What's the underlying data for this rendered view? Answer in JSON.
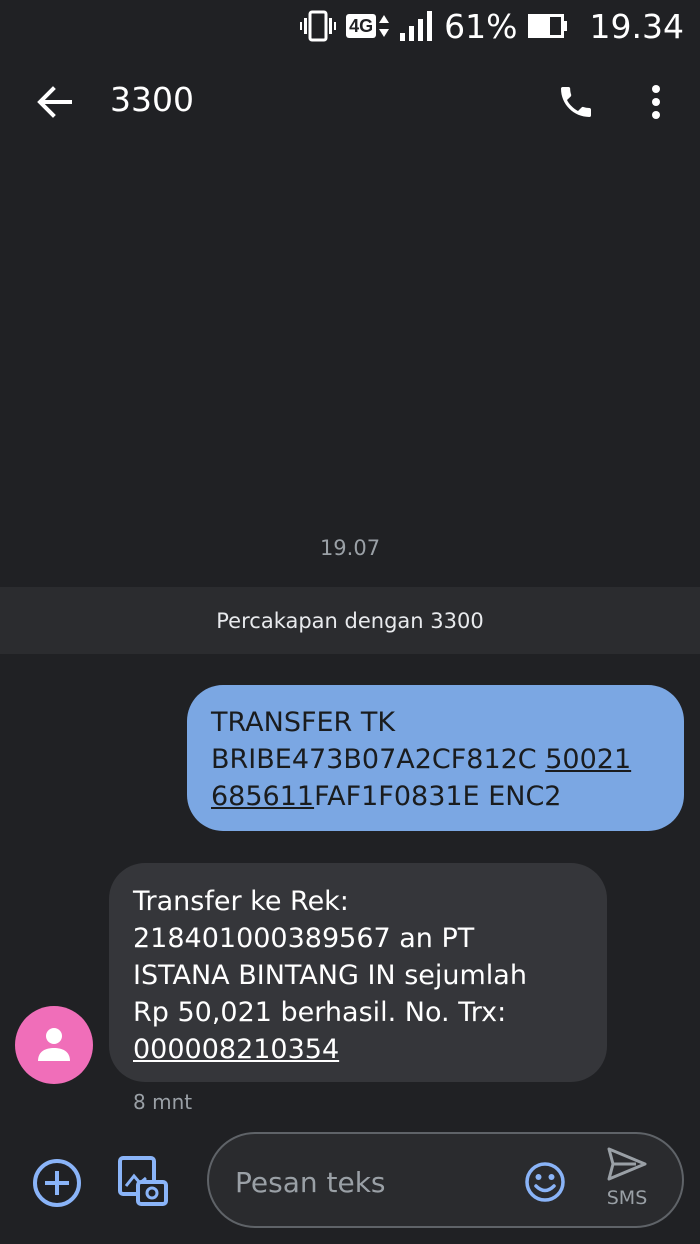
{
  "status_bar": {
    "network": "4G",
    "battery": "61%",
    "time": "19.34"
  },
  "app_bar": {
    "title": "3300"
  },
  "thread": {
    "date_separator": "19.07",
    "banner": "Percakapan dengan 3300",
    "outgoing": {
      "line1": "TRANSFER TK",
      "line2a": "BRIBE473B07A2CF812C ",
      "line2b": "50021",
      "line3a": "685611",
      "line3b": "FAF1F0831E ENC2"
    },
    "incoming": {
      "line1": "Transfer ke Rek:",
      "line2": "218401000389567 an PT",
      "line3": "ISTANA BINTANG IN sejumlah",
      "line4": "Rp 50,021 berhasil. No. Trx:",
      "line5": "000008210354",
      "time": "8 mnt"
    }
  },
  "compose": {
    "placeholder": "Pesan teks",
    "send_label": "SMS"
  },
  "colors": {
    "background": "#202124",
    "outgoing_bubble": "#7ba7e3",
    "incoming_bubble": "#35363a",
    "avatar": "#f06eb9",
    "accent": "#8ab4f8"
  },
  "icons": [
    "vibrate-icon",
    "network-4g-icon",
    "signal-icon",
    "battery-icon",
    "back-arrow-icon",
    "phone-icon",
    "more-vert-icon",
    "avatar-person-icon",
    "add-circle-icon",
    "gallery-camera-icon",
    "emoji-icon",
    "send-icon"
  ]
}
